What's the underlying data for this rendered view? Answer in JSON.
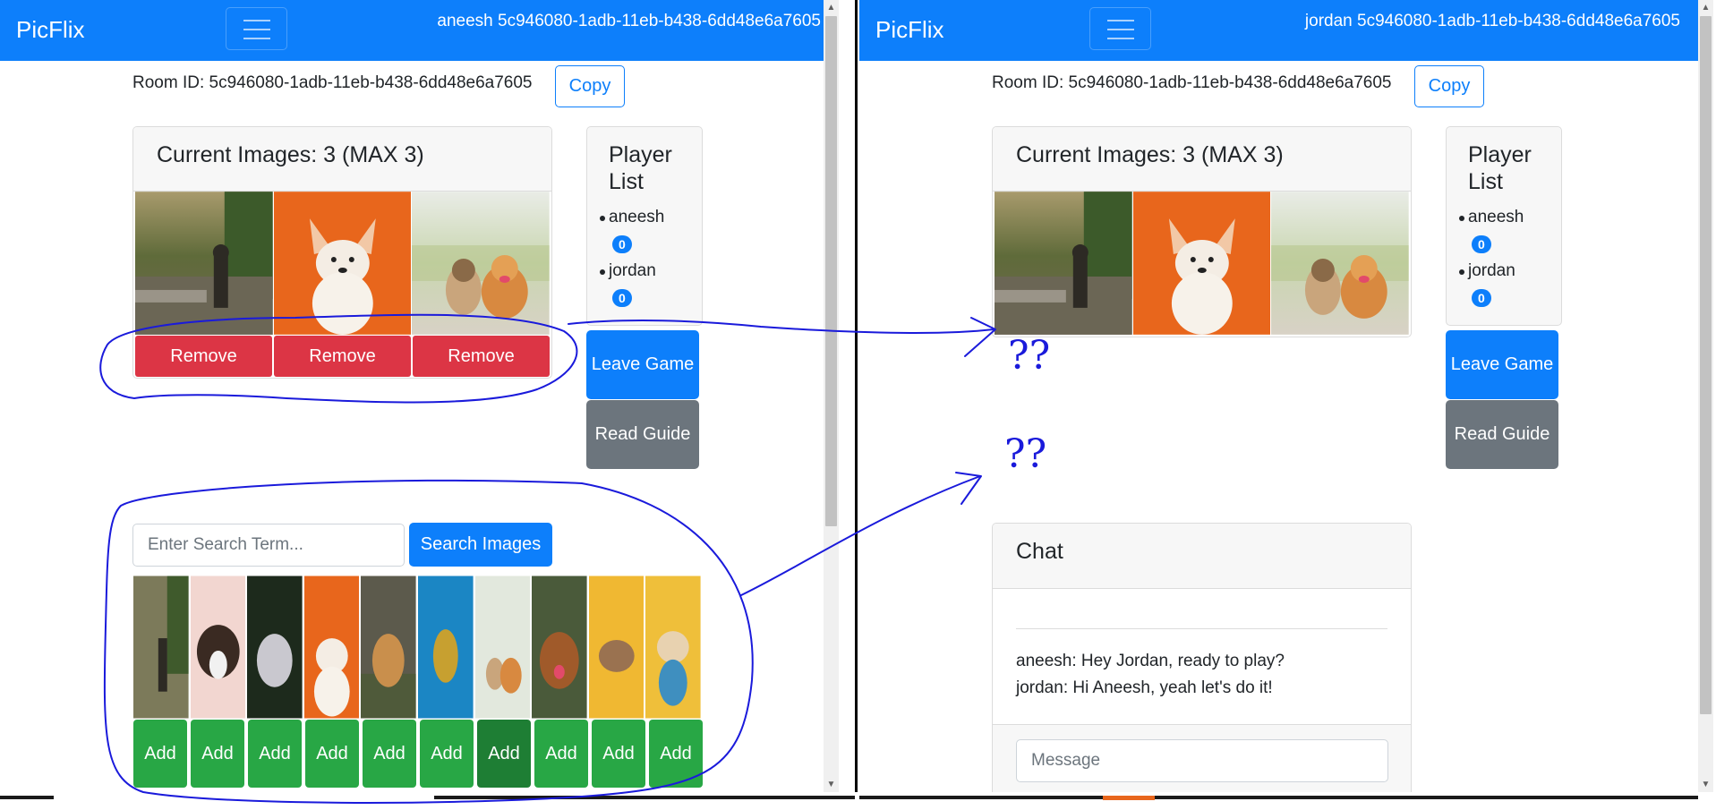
{
  "colors": {
    "primary": "#0d7ffb",
    "danger": "#dc3545",
    "success": "#28a745",
    "secondary": "#6c757d",
    "annotation_ink": "#1a1adb"
  },
  "left_window": {
    "brand": "PicFlix",
    "nav_user": "aneesh 5c946080-1adb-11eb-b438-6dd48e6a7605",
    "room_id_text": "Room ID: 5c946080-1adb-11eb-b438-6dd48e6a7605",
    "copy_label": "Copy",
    "current_images_title": "Current Images: 3 (MAX 3)",
    "current_images": [
      {
        "name": "dog-at-creek-image"
      },
      {
        "name": "corgi-on-orange-image"
      },
      {
        "name": "two-dogs-on-path-image"
      }
    ],
    "remove_label": "Remove",
    "player_list_title": "Player List",
    "players": [
      {
        "name": "aneesh",
        "score": "0"
      },
      {
        "name": "jordan",
        "score": "0"
      }
    ],
    "leave_label": "Leave Game",
    "guide_label": "Read Guide",
    "search_placeholder": "Enter Search Term...",
    "search_button": "Search Images",
    "add_label": "Add",
    "search_results_count": 10
  },
  "right_window": {
    "brand": "PicFlix",
    "nav_user": "jordan 5c946080-1adb-11eb-b438-6dd48e6a7605",
    "room_id_text": "Room ID: 5c946080-1adb-11eb-b438-6dd48e6a7605",
    "copy_label": "Copy",
    "current_images_title": "Current Images: 3 (MAX 3)",
    "player_list_title": "Player List",
    "players": [
      {
        "name": "aneesh",
        "score": "0"
      },
      {
        "name": "jordan",
        "score": "0"
      }
    ],
    "leave_label": "Leave Game",
    "guide_label": "Read Guide",
    "chat_title": "Chat",
    "chat_messages": [
      "aneesh: Hey Jordan, ready to play?",
      "jordan: Hi Aneesh, yeah let's do it!"
    ],
    "message_placeholder": "Message"
  },
  "annotations": {
    "mark_1": "??",
    "mark_2": "??"
  }
}
